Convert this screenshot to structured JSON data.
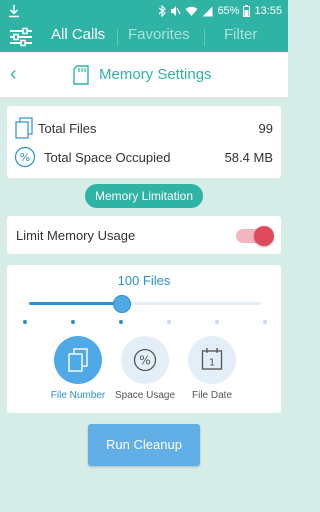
{
  "status": {
    "time": "13:55",
    "battery": "65%"
  },
  "appbar": {
    "tabs": [
      "All Calls",
      "Favorites",
      "Filter"
    ]
  },
  "header": {
    "title": "Memory Settings"
  },
  "files": {
    "total_files_label": "Total Files",
    "total_files_value": "99",
    "space_label": "Total Space Occupied",
    "space_value": "58.4 MB"
  },
  "limitation_pill": "Memory Limitation",
  "limit_toggle": {
    "label": "Limit Memory Usage",
    "enabled": true
  },
  "slider": {
    "value_text": "100 Files",
    "level": 0.4,
    "steps": 6,
    "active_step": 2
  },
  "modes": [
    {
      "label": "File Number",
      "icon": "files-icon",
      "active": true
    },
    {
      "label": "Space Usage",
      "icon": "percent-icon",
      "active": false
    },
    {
      "label": "File Date",
      "icon": "calendar-icon",
      "active": false
    }
  ],
  "run_button": "Run Cleanup",
  "colors": {
    "primary": "#2fb3a4",
    "accent_blue": "#2a8fd6",
    "toggle_on": "#e0485e"
  }
}
